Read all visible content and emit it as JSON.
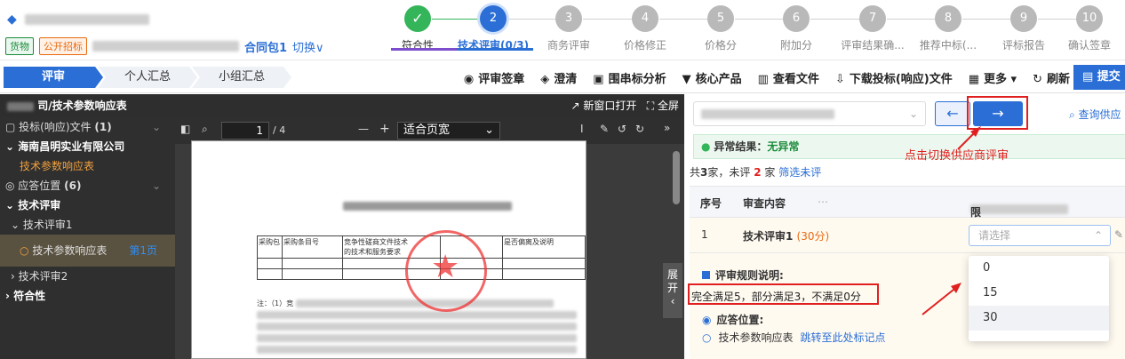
{
  "top": {
    "tags": [
      "货物",
      "公开招标"
    ],
    "pack": "合同包1",
    "switch": "切换∨",
    "steps": [
      {
        "num": "✓",
        "label": "符合性",
        "state": "done"
      },
      {
        "num": "2",
        "label": "技术评审(0/3)",
        "state": "cur"
      },
      {
        "num": "3",
        "label": "商务评审",
        "state": "todo"
      },
      {
        "num": "4",
        "label": "价格修正",
        "state": "todo"
      },
      {
        "num": "5",
        "label": "价格分",
        "state": "todo"
      },
      {
        "num": "6",
        "label": "附加分",
        "state": "todo"
      },
      {
        "num": "7",
        "label": "评审结果确...",
        "state": "todo"
      },
      {
        "num": "8",
        "label": "推荐中标(...",
        "state": "todo"
      },
      {
        "num": "9",
        "label": "评标报告",
        "state": "todo"
      },
      {
        "num": "10",
        "label": "确认签章",
        "state": "todo"
      }
    ]
  },
  "toolbar": {
    "tabs": [
      "评审",
      "个人汇总",
      "小组汇总"
    ],
    "tools": [
      {
        "icon": "◉",
        "label": "评审签章"
      },
      {
        "icon": "◈",
        "label": "澄清"
      },
      {
        "icon": "▣",
        "label": "围串标分析"
      },
      {
        "icon": "▼",
        "label": "核心产品"
      },
      {
        "icon": "▥",
        "label": "查看文件"
      },
      {
        "icon": "⇩",
        "label": "下载投标(响应)文件"
      },
      {
        "icon": "▦",
        "label": "更多 ▾"
      },
      {
        "icon": "↻",
        "label": "刷新"
      }
    ],
    "submit": "▤ 提交"
  },
  "left": {
    "title": "司/技术参数响应表",
    "new_window": "↗ 新窗口打开",
    "fullscreen": "⛶ 全屏",
    "tree": {
      "files": "▢ 投标(响应)文件",
      "files_count": "(1)",
      "company": "海南昌明实业有限公司",
      "table": "技术参数响应表",
      "pos_label": "◎ 应答位置",
      "pos_count": "(6)",
      "tech": "技术评审",
      "tech1": "技术评审1",
      "item": "技术参数响应表",
      "item_page": "第1页",
      "tech2": "技术评审2",
      "comp": "符合性"
    },
    "pdf": {
      "page": "1",
      "total": "/ 4",
      "zoom": "适合页宽",
      "minus": "—",
      "plus": "+"
    },
    "doc": {
      "h1": "采购包",
      "h2": "采购条目号",
      "h3": "竞争性磋商文件技术",
      "h3b": "的技术和服务要求",
      "h4": "是否偏离及说明",
      "note": "注：（1）竞"
    },
    "expand": "展开"
  },
  "right": {
    "next_arrow": "→",
    "prev_arrow": "←",
    "query": "⌕ 查询供应",
    "abn_label": "异常结果：",
    "abn_value": "无异常",
    "hint": "点击切换供应商评审",
    "count_pre": "共",
    "count_n": "3",
    "count_mid": "家，未评",
    "count_red": "2",
    "count_unit": "家",
    "filter": "筛选未评",
    "th_no": "序号",
    "th_content": "审查内容",
    "th_company": "限公司",
    "row_no": "1",
    "row_title": "技术评审1",
    "row_score": "(30分)",
    "select_placeholder": "请选择",
    "rule_label": "评审规则说明:",
    "rule_text": "完全满足5，部分满足3，不满足0分",
    "pos_label": "应答位置:",
    "pos_item": "技术参数响应表",
    "pos_link": "跳转至此处标记点",
    "options": [
      "0",
      "15",
      "30"
    ]
  },
  "colors": {
    "primary": "#2b6fd6",
    "success": "#34b55a",
    "alert": "#e02020",
    "warn": "#e86a10"
  }
}
